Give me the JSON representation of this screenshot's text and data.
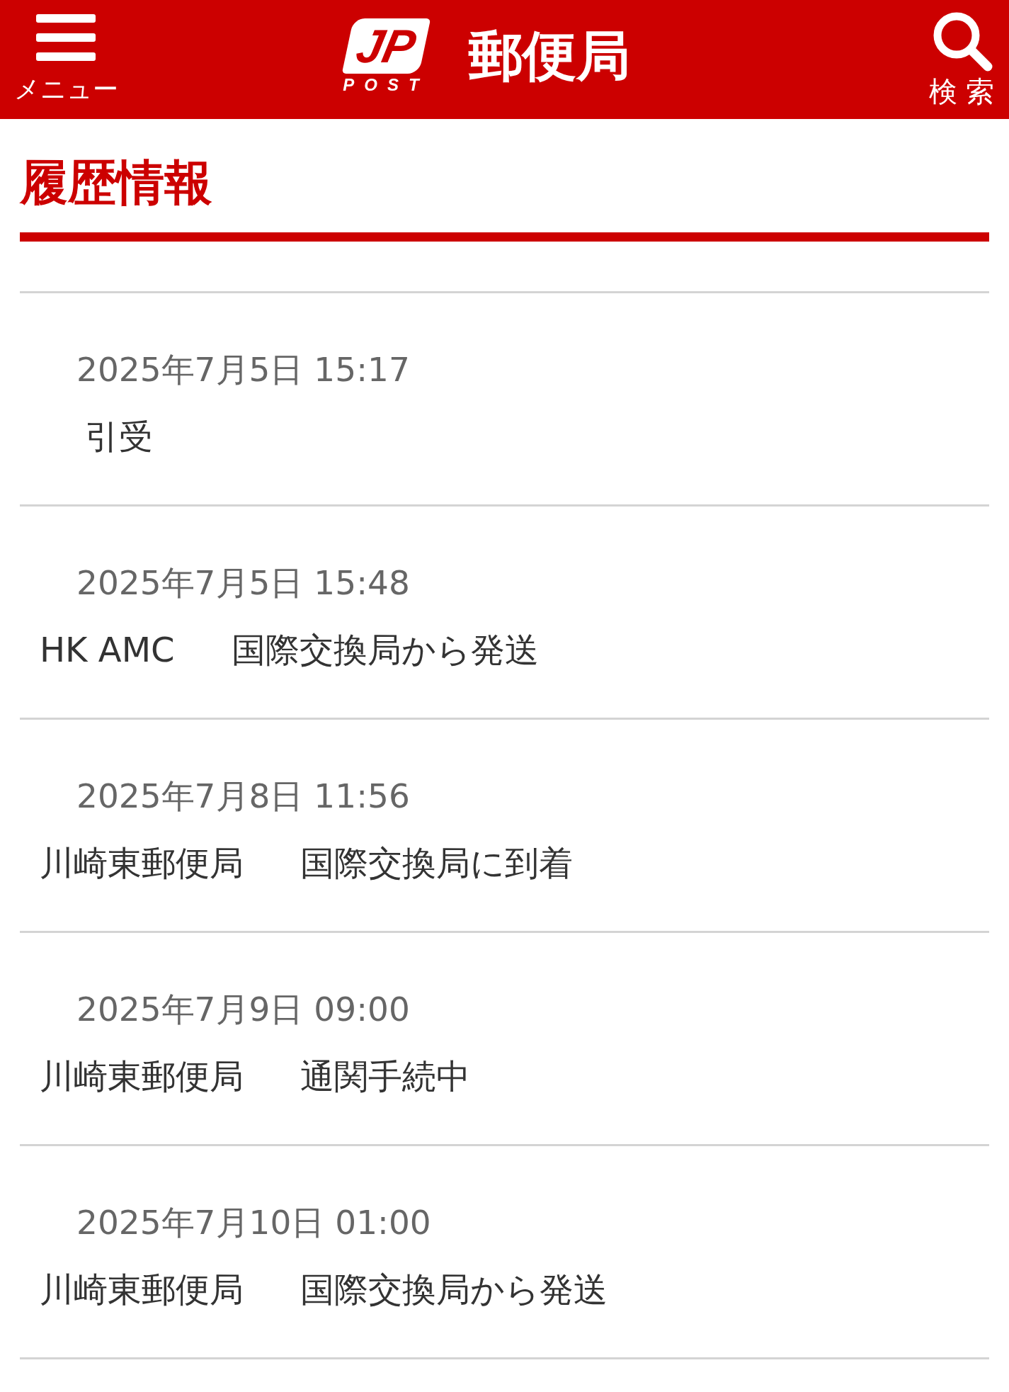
{
  "header": {
    "menu_label": "メニュー",
    "logo": {
      "mark": "JP",
      "sub": "POST"
    },
    "site_name": "郵便局",
    "search_label": "検 索"
  },
  "section_title": "履歴情報",
  "history": [
    {
      "datetime": "2025年7月5日 15:17",
      "status": "引受"
    },
    {
      "datetime": "2025年7月5日 15:48",
      "location": "HK AMC",
      "status": "国際交換局から発送"
    },
    {
      "datetime": "2025年7月8日 11:56",
      "location": "川崎東郵便局",
      "status": "国際交換局に到着"
    },
    {
      "datetime": "2025年7月9日 09:00",
      "location": "川崎東郵便局",
      "status": "通関手続中"
    },
    {
      "datetime": "2025年7月10日 01:00",
      "location": "川崎東郵便局",
      "status": "国際交換局から発送"
    }
  ]
}
